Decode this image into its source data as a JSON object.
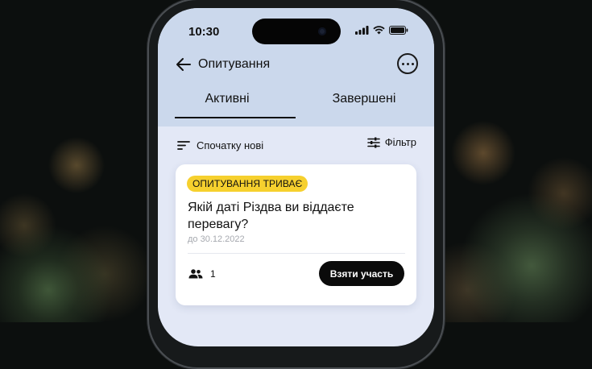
{
  "status_bar": {
    "time": "10:30",
    "icons": [
      "signal-icon",
      "wifi-icon",
      "battery-icon"
    ]
  },
  "top_bar": {
    "title": "Опитування",
    "back_icon": "arrow-left-icon",
    "more_icon": "more-icon"
  },
  "tabs": [
    {
      "label": "Активні",
      "active": true
    },
    {
      "label": "Завершені",
      "active": false
    }
  ],
  "toolbar": {
    "sort_label": "Спочатку нові",
    "filter_label": "Фільтр"
  },
  "poll": {
    "status": "ОПИТУВАННЯ ТРИВАЄ",
    "question": "Якій даті Різдва ви віддаєте перевагу?",
    "deadline": "до 30.12.2022",
    "participants": "1",
    "action_label": "Взяти участь"
  },
  "colors": {
    "accent": "#f6d02e",
    "header": "#cbd8ec",
    "background": "#e3e8f6",
    "button": "#0b0b0b"
  }
}
